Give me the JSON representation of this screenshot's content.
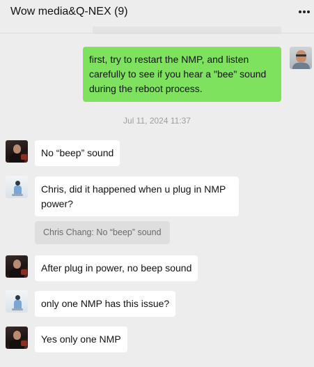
{
  "header": {
    "title": "Wow media&Q-NEX  (9)",
    "more_icon": "more-horizontal-icon"
  },
  "messages": [
    {
      "sender": "me",
      "text": "first, try to restart the NMP, and listen carefully to see if you hear a \"bee\" sound during the reboot process.",
      "lines": [
        "first, try to restart the NMP, and listen",
        "carefully to see if you hear a \"bee\" sound",
        "during the reboot process."
      ]
    },
    {
      "sender": "other-dark",
      "text": "No “beep” sound"
    },
    {
      "sender": "other-light",
      "text": "Chris, did it happened when u plug in NMP power?",
      "lines": [
        "Chris, did it happened when u plug in NMP",
        "power?"
      ],
      "quote": "Chris Chang: No “beep” sound"
    },
    {
      "sender": "other-dark",
      "text": "After plug in power, no beep sound"
    },
    {
      "sender": "other-light",
      "text": "only one NMP has this issue?"
    },
    {
      "sender": "other-dark",
      "text": "Yes only one NMP"
    }
  ],
  "timestamp": "Jul 11, 2024 11:37",
  "colors": {
    "background": "#ededed",
    "my_bubble": "#7ee25f",
    "their_bubble": "#ffffff",
    "quote_bg": "#dedede"
  }
}
